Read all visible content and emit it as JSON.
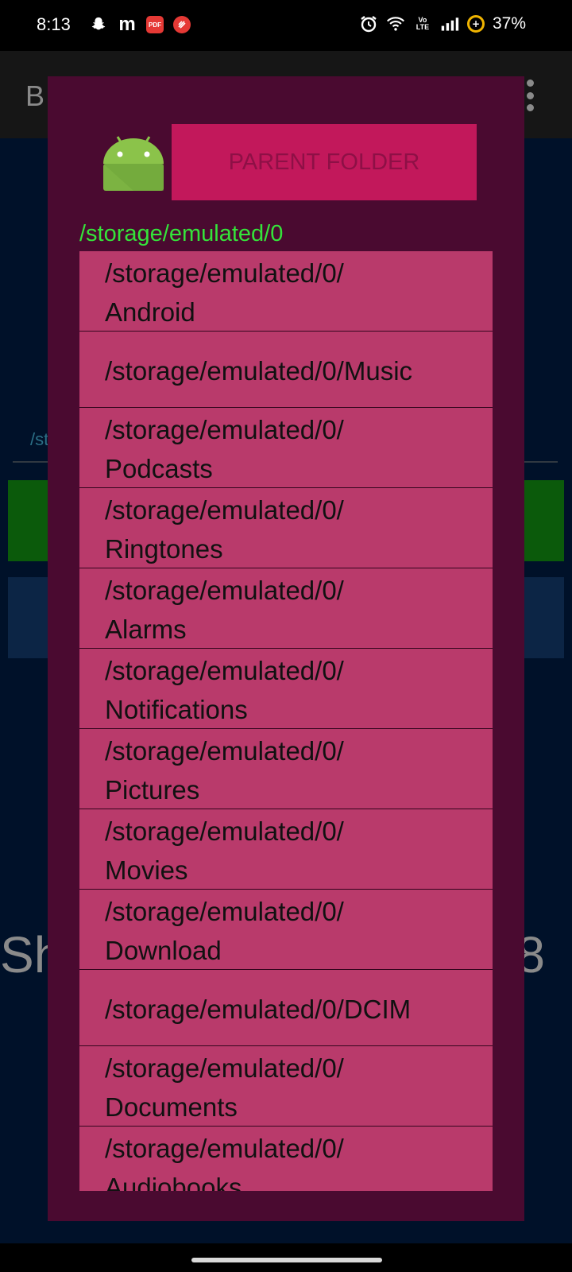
{
  "status_bar": {
    "time": "8:13",
    "left_icons": [
      "snapchat-icon",
      "m-icon",
      "pdf-icon",
      "red-app-icon"
    ],
    "m_glyph": "m",
    "pdf_label": "PDF",
    "volte_top": "Vo",
    "volte_bottom": "LTE",
    "battery": "37%"
  },
  "background_app": {
    "title": "B",
    "path_fragment": "/st",
    "big_text_left": "Sh",
    "big_text_right": "8"
  },
  "dialog": {
    "parent_button_label": "PARENT FOLDER",
    "current_path": "/storage/emulated/0",
    "items": [
      {
        "line1": "/storage/emulated/0/",
        "line2": "Android"
      },
      {
        "line1": "/storage/emulated/0/Music",
        "line2": ""
      },
      {
        "line1": "/storage/emulated/0/",
        "line2": "Podcasts"
      },
      {
        "line1": "/storage/emulated/0/",
        "line2": "Ringtones"
      },
      {
        "line1": "/storage/emulated/0/",
        "line2": "Alarms"
      },
      {
        "line1": "/storage/emulated/0/",
        "line2": "Notifications"
      },
      {
        "line1": "/storage/emulated/0/",
        "line2": "Pictures"
      },
      {
        "line1": "/storage/emulated/0/",
        "line2": "Movies"
      },
      {
        "line1": "/storage/emulated/0/",
        "line2": "Download"
      },
      {
        "line1": "/storage/emulated/0/DCIM",
        "line2": ""
      },
      {
        "line1": "/storage/emulated/0/",
        "line2": "Documents"
      },
      {
        "line1": "/storage/emulated/0/",
        "line2": "Audiobooks"
      }
    ]
  },
  "colors": {
    "dialog_bg": "#4a0a30",
    "button_bg": "#c2185b",
    "list_bg": "#b93a6b",
    "path_green": "#35e33a"
  }
}
